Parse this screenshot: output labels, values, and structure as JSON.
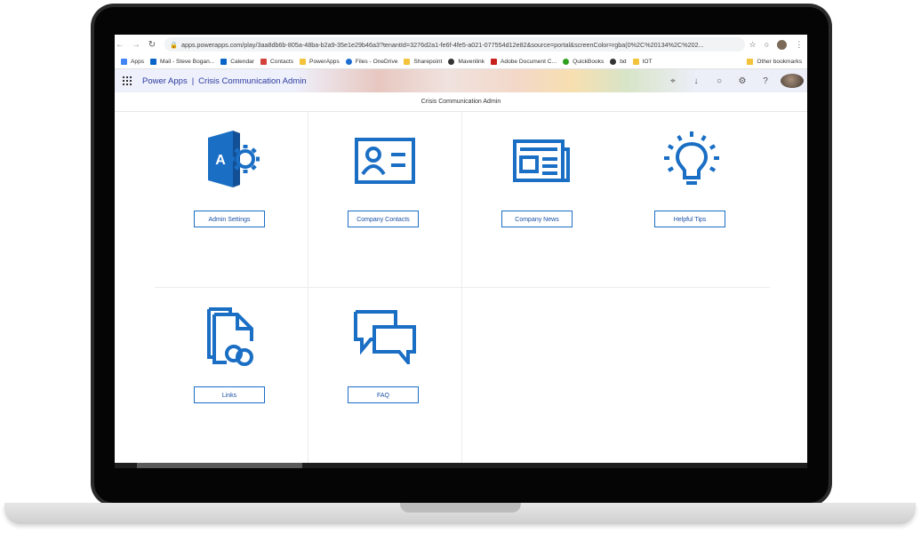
{
  "browser": {
    "url": "apps.powerapps.com/play/3aa8db6b-805a-48ba-b2a9-35e1e29b46a3?tenantId=3276d2a1-fe6f-4fe5-a021-077554d12e82&source=portal&screenColor=rgba(0%2C%20134%2C%202...",
    "back_icon": "arrow-left-icon",
    "forward_icon": "arrow-right-icon",
    "reload_icon": "reload-icon",
    "star_icon": "star-icon"
  },
  "bookmarks": {
    "items": [
      {
        "label": "Apps",
        "color": "#4285f4"
      },
      {
        "label": "Mail - Steve Bogan...",
        "color": "#0a64c8"
      },
      {
        "label": "Calendar",
        "color": "#0a64c8"
      },
      {
        "label": "Contacts",
        "color": "#d2413a"
      },
      {
        "label": "PowerApps",
        "color": "#f3c33c"
      },
      {
        "label": "Files - OneDrive",
        "color": "#1e6fd0"
      },
      {
        "label": "Sharepoint",
        "color": "#f3c33c"
      },
      {
        "label": "Mavenlink",
        "color": "#333333"
      },
      {
        "label": "Adobe Document C...",
        "color": "#c8201c"
      },
      {
        "label": "QuickBooks",
        "color": "#2ca01c"
      },
      {
        "label": "bd",
        "color": "#333333"
      },
      {
        "label": "IOT",
        "color": "#f3c33c"
      }
    ],
    "other": "Other bookmarks"
  },
  "appbar": {
    "product": "Power Apps",
    "separator": "|",
    "app_name": "Crisis Communication Admin"
  },
  "page": {
    "title": "Crisis Communication Admin"
  },
  "tiles": [
    {
      "label": "Admin Settings",
      "icon": "admin-settings-icon"
    },
    {
      "label": "Company Contacts",
      "icon": "contact-card-icon"
    },
    {
      "label": "Company News",
      "icon": "newspaper-icon"
    },
    {
      "label": "Helpful Tips",
      "icon": "lightbulb-icon"
    },
    {
      "label": "Links",
      "icon": "links-document-icon"
    },
    {
      "label": "FAQ",
      "icon": "chat-bubbles-icon"
    }
  ],
  "colors": {
    "accent": "#1a6ec4",
    "appbar_text": "#2b3a9f"
  }
}
